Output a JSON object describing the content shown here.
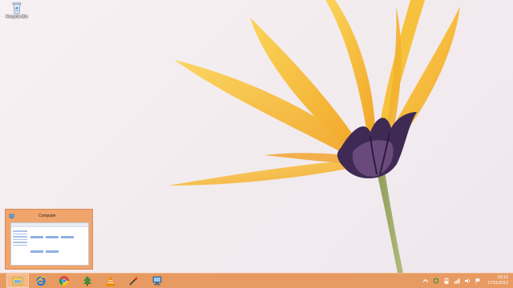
{
  "desktop": {
    "icons": [
      {
        "name": "recycle-bin",
        "label": "Recycle Bin",
        "icon": "recycle-bin-icon"
      }
    ]
  },
  "thumbnail": {
    "title": "Computer",
    "icon": "computer-icon"
  },
  "taskbar": {
    "buttons": [
      {
        "id": "file-explorer",
        "icon": "file-explorer-icon",
        "active": true
      },
      {
        "id": "internet-explorer",
        "icon": "internet-explorer-icon",
        "active": false
      },
      {
        "id": "chrome",
        "icon": "chrome-icon",
        "active": false
      },
      {
        "id": "app-4",
        "icon": "tree-app-icon",
        "active": false
      },
      {
        "id": "vlc",
        "icon": "vlc-icon",
        "active": false
      },
      {
        "id": "app-6",
        "icon": "paint-tool-icon",
        "active": false
      },
      {
        "id": "app-7",
        "icon": "network-computer-icon",
        "active": false
      }
    ],
    "tray": [
      "chevron-up-icon",
      "sync-icon",
      "battery-icon",
      "network-icon",
      "volume-icon",
      "flag-icon"
    ],
    "clock": {
      "time": "03:15",
      "date": "17/11/2012"
    }
  },
  "colors": {
    "taskbar": "#e79b62",
    "thumbnail": "#f0a56d",
    "petal": "#f5b833"
  }
}
